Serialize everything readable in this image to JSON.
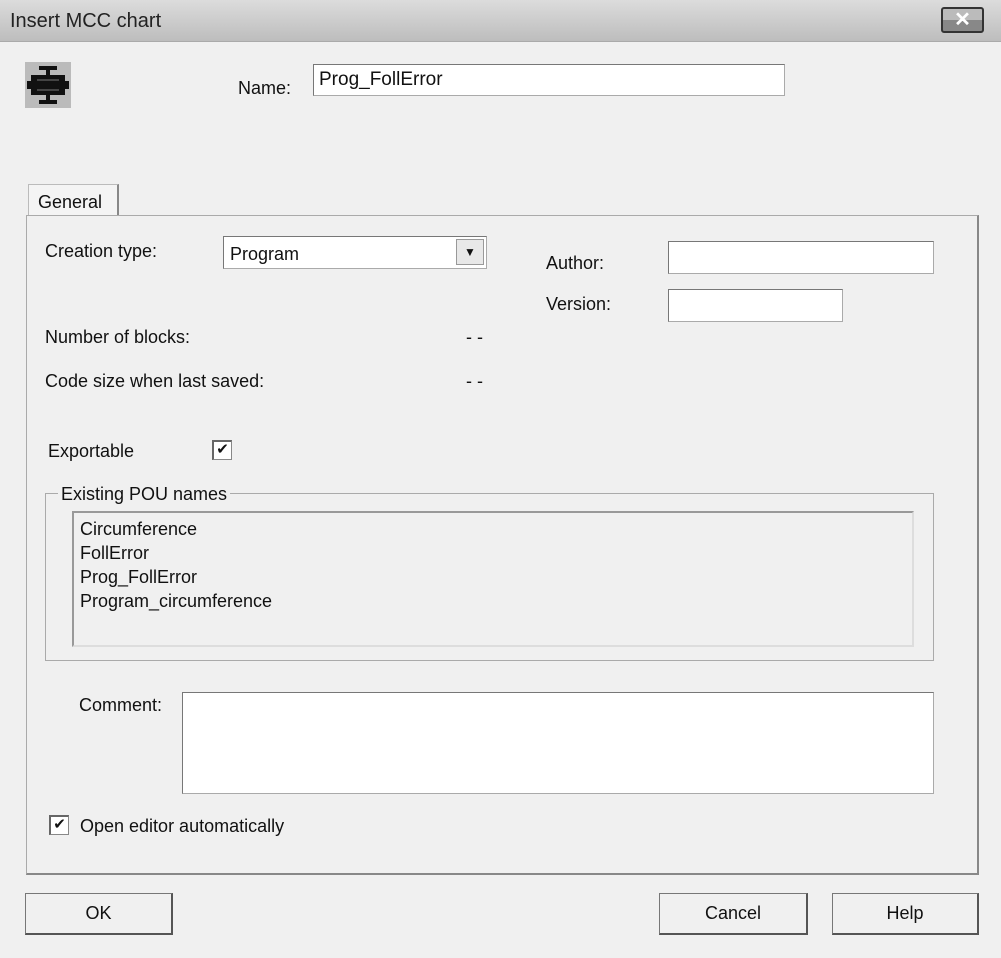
{
  "window": {
    "title": "Insert MCC chart",
    "close_icon": "close-icon"
  },
  "name": {
    "label": "Name:",
    "value": "Prog_FollError"
  },
  "tabs": [
    {
      "label": "General"
    }
  ],
  "general": {
    "creation_type_label": "Creation type:",
    "creation_type_value": "Program",
    "author_label": "Author:",
    "author_value": "",
    "version_label": "Version:",
    "version_value": "",
    "blocks_label": "Number of blocks:",
    "blocks_value": "- -",
    "code_size_label": "Code size when last saved:",
    "code_size_value": "- -",
    "exportable_label": "Exportable",
    "exportable_checked": true,
    "pou_group_label": "Existing POU names",
    "pou_names": [
      "Circumference",
      "FollError",
      "Prog_FollError",
      "Program_circumference"
    ],
    "comment_label": "Comment:",
    "comment_value": "",
    "open_editor_label": "Open editor automatically",
    "open_editor_checked": true
  },
  "buttons": {
    "ok": "OK",
    "cancel": "Cancel",
    "help": "Help"
  }
}
